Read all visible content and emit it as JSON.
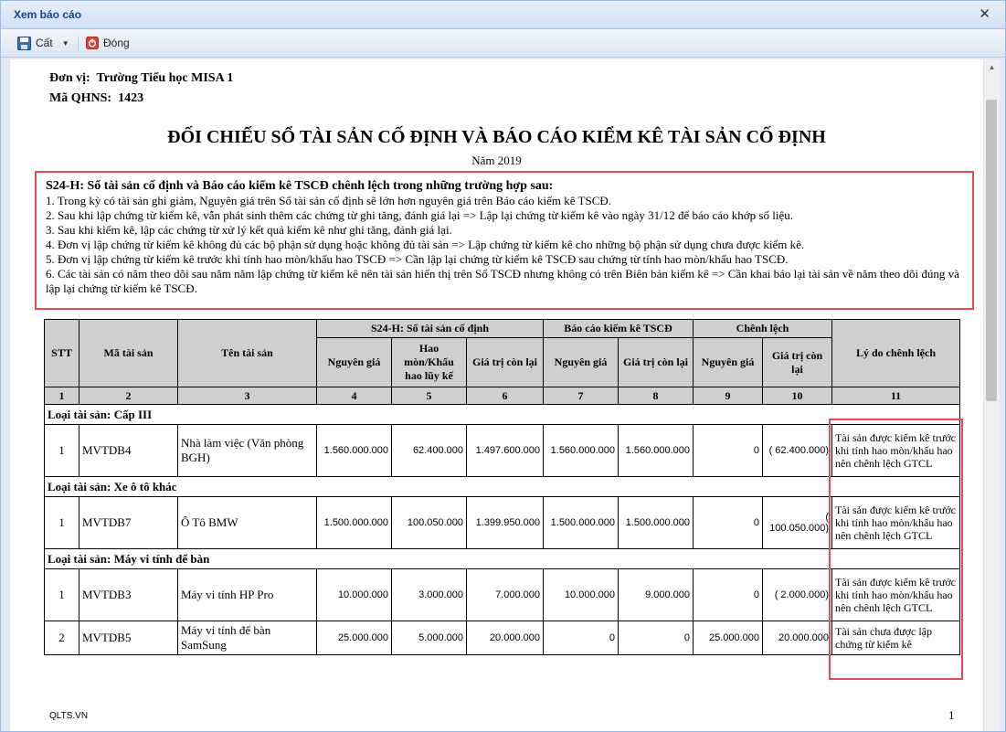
{
  "window": {
    "title": "Xem báo cáo"
  },
  "toolbar": {
    "cut_label": "Cất",
    "close_label": "Đóng"
  },
  "report": {
    "unit_label": "Đơn vị:",
    "unit_value": "Trường Tiểu học MISA 1",
    "code_label": "Mã QHNS:",
    "code_value": "1423",
    "title": "ĐỐI CHIẾU SỔ TÀI SẢN CỐ ĐỊNH VÀ BÁO CÁO KIỂM KÊ TÀI SẢN CỐ ĐỊNH",
    "year": "Năm 2019",
    "footer_left": "QLTS.VN",
    "page_number": "1"
  },
  "note": {
    "title": "S24-H: Sổ tài sản cố định và Báo cáo kiểm kê TSCĐ chênh lệch trong những trường hợp sau:",
    "lines": [
      "1. Trong kỳ có tài sản ghi giảm, Nguyên giá trên Sổ tài sản cố định sẽ lớn hơn nguyên giá trên Báo cáo kiểm kê TSCĐ.",
      "2. Sau khi lập chứng từ kiểm kê, vẫn phát sinh thêm các chứng từ ghi tăng, đánh giá lại => Lập lại chứng từ kiểm kê vào ngày 31/12 để báo cáo khớp số liệu.",
      "3. Sau khi kiểm kê, lập các chứng từ xử lý kết quả kiểm kê như ghi tăng, đánh giá lại.",
      "4. Đơn vị lập chứng từ kiểm kê không đủ các bộ phận sử dụng hoặc không đủ tài sản => Lập chứng từ kiểm kê cho những bộ phận sử dụng chưa được kiểm kê.",
      "5. Đơn vị lập chứng từ kiểm kê trước khi tính hao mòn/khấu hao TSCĐ => Cần lập lại chứng từ kiểm kê TSCĐ sau chứng từ tính hao mòn/khấu hao TSCĐ.",
      "6. Các tài sản có năm theo dõi sau năm năm lập chứng từ kiểm kê nên tài sản hiển thị trên Sổ TSCĐ nhưng không có trên Biên bản kiểm kê => Cần khai báo lại tài sản về năm theo dõi đúng và lập lại chứng từ kiểm kê TSCĐ."
    ]
  },
  "table": {
    "h_stt": "STT",
    "h_code": "Mã tài sản",
    "h_name": "Tên tài sản",
    "h_g1": "S24-H: Sổ tài sản cố định",
    "h_g2": "Báo cáo kiểm kê TSCĐ",
    "h_g3": "Chênh lệch",
    "h_reason": "Lý do chênh lệch",
    "h_ng1": "Nguyên giá",
    "h_hm": "Hao mòn/Khấu hao lũy kế",
    "h_gtcl1": "Giá trị còn lại",
    "h_ng2": "Nguyên giá",
    "h_gtcl2": "Giá trị còn lại",
    "h_ng3": "Nguyên giá",
    "h_gtcl3": "Giá trị còn lại",
    "col_numbers": [
      "1",
      "2",
      "3",
      "4",
      "5",
      "6",
      "7",
      "8",
      "9",
      "10",
      "11"
    ],
    "groups": [
      {
        "label": "Loại tài sản: Cấp III",
        "rows": [
          {
            "stt": "1",
            "code": "MVTDB4",
            "name": "Nhà làm việc (Văn phòng BGH)",
            "ng1": "1.560.000.000",
            "hm": "62.400.000",
            "gtcl1": "1.497.600.000",
            "ng2": "1.560.000.000",
            "gtcl2": "1.560.000.000",
            "cl_ng": "0",
            "cl_gtcl": "( 62.400.000)",
            "reason": "Tài sản được kiểm kê trước khi tính hao mòn/khấu hao nên chênh lệch GTCL"
          }
        ]
      },
      {
        "label": "Loại tài sản: Xe ô tô khác",
        "rows": [
          {
            "stt": "1",
            "code": "MVTDB7",
            "name": "Ô Tô BMW",
            "ng1": "1.500.000.000",
            "hm": "100.050.000",
            "gtcl1": "1.399.950.000",
            "ng2": "1.500.000.000",
            "gtcl2": "1.500.000.000",
            "cl_ng": "0",
            "cl_gtcl": "( 100.050.000)",
            "reason": "Tài sản được kiểm kê trước khi tính hao mòn/khấu hao nên chênh lệch GTCL"
          }
        ]
      },
      {
        "label": "Loại tài sản: Máy vi tính để bàn",
        "rows": [
          {
            "stt": "1",
            "code": "MVTDB3",
            "name": "Máy vi tính HP Pro",
            "ng1": "10.000.000",
            "hm": "3.000.000",
            "gtcl1": "7.000.000",
            "ng2": "10.000.000",
            "gtcl2": "9.000.000",
            "cl_ng": "0",
            "cl_gtcl": "( 2.000.000)",
            "reason": "Tài sản được kiểm kê trước khi tính hao mòn/khấu hao nên chênh lệch GTCL"
          },
          {
            "stt": "2",
            "code": "MVTDB5",
            "name": "Máy vi tính để bàn SamSung",
            "ng1": "25.000.000",
            "hm": "5.000.000",
            "gtcl1": "20.000.000",
            "ng2": "0",
            "gtcl2": "0",
            "cl_ng": "25.000.000",
            "cl_gtcl": "20.000.000",
            "reason": "Tài sản chưa được lập chứng từ kiểm kê"
          }
        ]
      }
    ]
  }
}
